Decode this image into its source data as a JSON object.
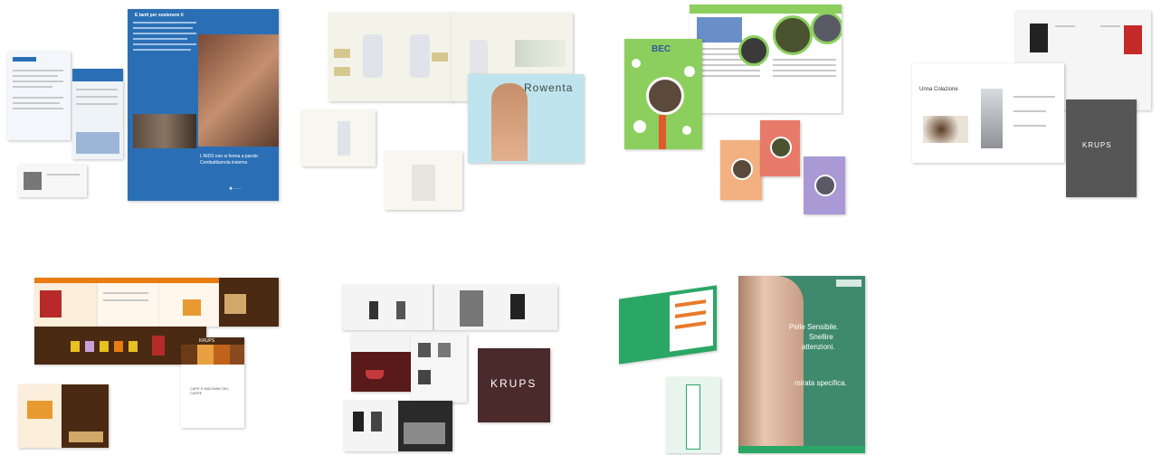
{
  "gallery": {
    "items": [
      {
        "name": "aids-brochure",
        "headline": "L'AIDS non si ferma a parole. Combattiamola insieme.",
        "panel_title": "E tanti per sostenere il"
      },
      {
        "name": "rowenta-catalog",
        "brand": "Rowenta"
      },
      {
        "name": "bec-magazine",
        "brand": "BEC"
      },
      {
        "name": "krups-coffee-catalog",
        "brand": "KRUPS",
        "spread_title": "Unna Colazione"
      },
      {
        "name": "caffe-brochure",
        "brand": "KRUPS",
        "cover_text": "CAFE E MACHINE DEL CAFFE"
      },
      {
        "name": "krups-catalog-2",
        "brand": "KRUPS"
      },
      {
        "name": "somatoline-campaign",
        "headline_1": "Pelle Sensibile.",
        "headline_2": "Snellire",
        "headline_3": "attenzioni.",
        "headline_4": "mirata specifica."
      }
    ]
  },
  "colors": {
    "aids_blue": "#2a6fb5",
    "rowenta_bg": "#f4f3ea",
    "bec_green": "#8ccf5e",
    "krups_dark": "#565656",
    "coffee_brown": "#4a2a12",
    "coffee_orange": "#e87d12",
    "krups_burgundy": "#4a2a2a",
    "soma_green": "#2aa765"
  }
}
